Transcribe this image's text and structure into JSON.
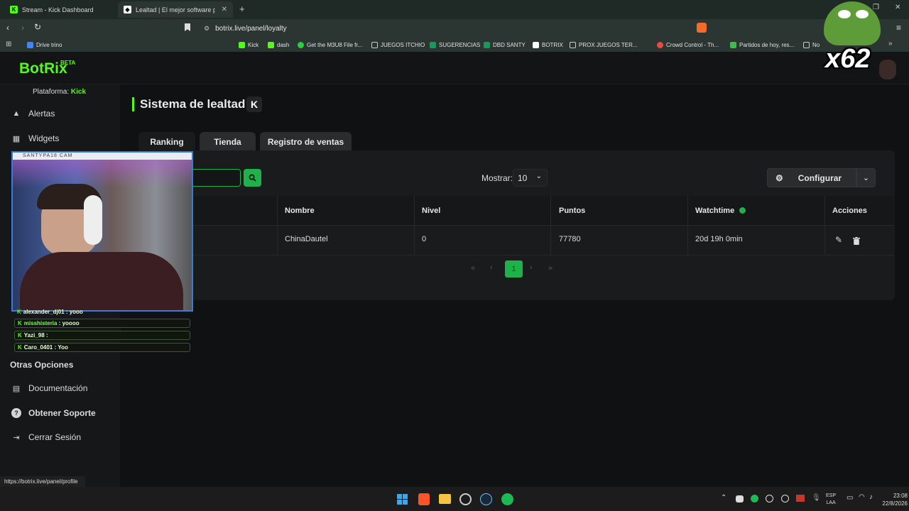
{
  "browser": {
    "tabs": [
      {
        "label": "Stream - Kick Dashboard",
        "active": false
      },
      {
        "label": "Lealtad | El mejor software para ...",
        "active": true
      }
    ],
    "url": "botrix.live/panel/loyalty",
    "bookmarks": [
      "Drive trino",
      "Kick",
      "dash",
      "Get the M3U8 File fr...",
      "JUEGOS ITCHIO",
      "SUGERENCIAS",
      "DBD SANTY",
      "BOTRIX",
      "PROX JUEGOS TER...",
      "Crowd Control - Th...",
      "Partidos de hoy, res...",
      "No"
    ],
    "status_url": "https://botrix.live/panel/profile"
  },
  "app": {
    "logo": "BotRix",
    "logo_badge": "BETA",
    "platform_label": "Plataforma:",
    "platform_value": "Kick",
    "nav": {
      "alertas": "Alertas",
      "widgets": "Widgets",
      "otras_opciones": "Otras Opciones",
      "documentacion": "Documentación",
      "soporte": "Obtener Soporte",
      "cerrar": "Cerrar Sesión"
    },
    "page_title": "Sistema de lealtad",
    "tabs": [
      "Ranking",
      "Tienda",
      "Registro de ventas"
    ],
    "mostrar_label": "Mostrar:",
    "mostrar_value": "10",
    "configurar_label": "Configurar",
    "table": {
      "headers": [
        "Nombre",
        "Nivel",
        "Puntos",
        "Watchtime",
        "Acciones"
      ],
      "rows": [
        {
          "nombre": "ChinaDautel",
          "nivel": "0",
          "puntos": "77780",
          "watchtime": "20d 19h 0min"
        }
      ]
    },
    "pagination": {
      "current": "1"
    }
  },
  "overlay": {
    "cam_label": "SANTYPA18 CAM",
    "counter": "x62",
    "chat": [
      {
        "user": "alexander_dj01",
        "msg": "yooo"
      },
      {
        "user": "misshisteria",
        "msg": "yoooo"
      },
      {
        "user": "Yazi_98",
        "msg": ":"
      },
      {
        "user": "Caro_0401",
        "msg": "Yoo"
      }
    ]
  },
  "taskbar": {
    "lang": "ESP",
    "lang2": "LAA",
    "time": "23:08",
    "date": "22/8/2026"
  },
  "colors": {
    "accent_green": "#53fc18",
    "button_green": "#1fb24a",
    "panel": "#1a1b1c"
  }
}
